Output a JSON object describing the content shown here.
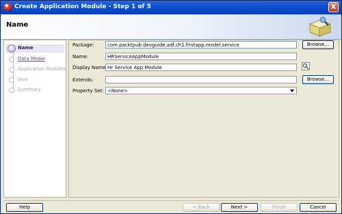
{
  "window": {
    "title": "Create Application Module - Step 1 of 5",
    "close": "X"
  },
  "header": {
    "title": "Name"
  },
  "nav": [
    {
      "label": "Name",
      "state": "active"
    },
    {
      "label": "Data Model",
      "state": "link"
    },
    {
      "label": "Application Modules",
      "state": "disabled"
    },
    {
      "label": "Java",
      "state": "disabled"
    },
    {
      "label": "Summary",
      "state": "disabled"
    }
  ],
  "form": {
    "package": {
      "label": "Package:",
      "value": "com.packtpub.devguide.adf.ch1.firstapp.model.service"
    },
    "name": {
      "label": "Name:",
      "value": "HRServiceAppModule"
    },
    "display_name": {
      "label": "Display Name:",
      "value": "Hr Service App Module"
    },
    "extends": {
      "label": "Extends:",
      "value": ""
    },
    "property_set": {
      "label": "Property Set:",
      "value": "<None>"
    },
    "browse": "Browse..."
  },
  "footer": {
    "help": "Help",
    "back": "< Back",
    "next": "Next >",
    "finish": "Finish",
    "cancel": "Cancel"
  }
}
